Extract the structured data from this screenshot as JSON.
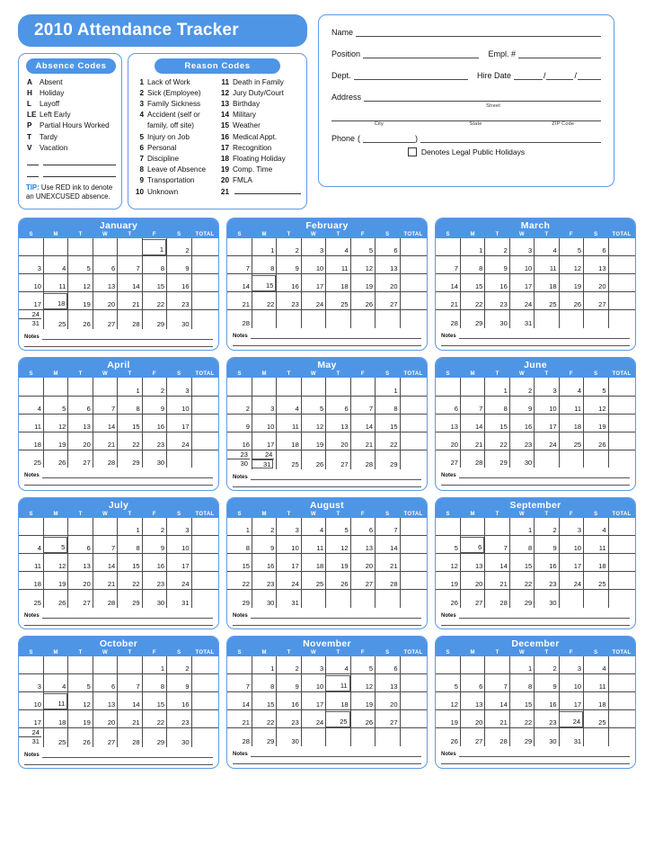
{
  "header": {
    "title": "2010 Attendance Tracker"
  },
  "absence_codes": {
    "heading": "Absence Codes",
    "items": [
      {
        "code": "A",
        "label": "Absent"
      },
      {
        "code": "H",
        "label": "Holiday"
      },
      {
        "code": "L",
        "label": "Layoff"
      },
      {
        "code": "LE",
        "label": "Left Early"
      },
      {
        "code": "P",
        "label": "Partial Hours Worked"
      },
      {
        "code": "T",
        "label": "Tardy"
      },
      {
        "code": "V",
        "label": "Vacation"
      }
    ],
    "blank_rows": 2,
    "tip_keyword": "TIP:",
    "tip_text": " Use RED ink to denote an UNEXCUSED absence.",
    "tip_color": "#2a7fd4"
  },
  "reason_codes": {
    "heading": "Reason Codes",
    "column_left": [
      {
        "code": "1",
        "label": "Lack of Work"
      },
      {
        "code": "2",
        "label": "Sick (Employee)"
      },
      {
        "code": "3",
        "label": "Family Sickness"
      },
      {
        "code": "4",
        "label": "Accident (self or family, off site)"
      },
      {
        "code": "5",
        "label": "Injury on Job"
      },
      {
        "code": "6",
        "label": "Personal"
      },
      {
        "code": "7",
        "label": "Discipline"
      },
      {
        "code": "8",
        "label": "Leave of Absence"
      },
      {
        "code": "9",
        "label": "Transportation"
      },
      {
        "code": "10",
        "label": "Unknown"
      }
    ],
    "column_right": [
      {
        "code": "11",
        "label": "Death in Family"
      },
      {
        "code": "12",
        "label": "Jury Duty/Court"
      },
      {
        "code": "13",
        "label": "Birthday"
      },
      {
        "code": "14",
        "label": "Military"
      },
      {
        "code": "15",
        "label": "Weather"
      },
      {
        "code": "16",
        "label": "Medical Appt."
      },
      {
        "code": "17",
        "label": "Recognition"
      },
      {
        "code": "18",
        "label": "Floating Holiday"
      },
      {
        "code": "19",
        "label": "Comp. Time"
      },
      {
        "code": "20",
        "label": "FMLA"
      },
      {
        "code": "21",
        "label": ""
      }
    ]
  },
  "employee_form": {
    "name_label": "Name",
    "position_label": "Position",
    "empl_num_label": "Empl. #",
    "dept_label": "Dept.",
    "hire_date_label": "Hire Date",
    "hire_date_sep": "/",
    "address_label": "Address",
    "street_caption": "Street",
    "city_caption": "City",
    "state_caption": "State",
    "zip_caption": "ZIP Code",
    "phone_label": "Phone",
    "phone_paren_open": "(",
    "phone_paren_close": ")",
    "holiday_checkbox_label": "Denotes Legal Public Holidays"
  },
  "calendar": {
    "dow": [
      "S",
      "M",
      "T",
      "W",
      "T",
      "F",
      "S"
    ],
    "total_label": "TOTAL",
    "notes_label": "Notes",
    "accent_color": "#4e95e6",
    "border_color": "#5b9ae8",
    "holiday_outline_color": "#5a5a5a",
    "months": [
      {
        "name": "January",
        "weeks": [
          [
            "",
            "",
            "",
            "",
            "",
            "1",
            "2"
          ],
          [
            "3",
            "4",
            "5",
            "6",
            "7",
            "8",
            "9"
          ],
          [
            "10",
            "11",
            "12",
            "13",
            "14",
            "15",
            "16"
          ],
          [
            "17",
            "18",
            "19",
            "20",
            "21",
            "22",
            "23"
          ],
          [
            {
              "split": [
                "24",
                "31"
              ]
            },
            "25",
            "26",
            "27",
            "28",
            "29",
            "30"
          ]
        ],
        "holidays": [
          "1",
          "18"
        ]
      },
      {
        "name": "February",
        "weeks": [
          [
            "",
            "1",
            "2",
            "3",
            "4",
            "5",
            "6"
          ],
          [
            "7",
            "8",
            "9",
            "10",
            "11",
            "12",
            "13"
          ],
          [
            "14",
            "15",
            "16",
            "17",
            "18",
            "19",
            "20"
          ],
          [
            "21",
            "22",
            "23",
            "24",
            "25",
            "26",
            "27"
          ],
          [
            "28",
            "",
            "",
            "",
            "",
            "",
            ""
          ]
        ],
        "holidays": [
          "15"
        ]
      },
      {
        "name": "March",
        "weeks": [
          [
            "",
            "1",
            "2",
            "3",
            "4",
            "5",
            "6"
          ],
          [
            "7",
            "8",
            "9",
            "10",
            "11",
            "12",
            "13"
          ],
          [
            "14",
            "15",
            "16",
            "17",
            "18",
            "19",
            "20"
          ],
          [
            "21",
            "22",
            "23",
            "24",
            "25",
            "26",
            "27"
          ],
          [
            "28",
            "29",
            "30",
            "31",
            "",
            "",
            ""
          ]
        ],
        "holidays": []
      },
      {
        "name": "April",
        "weeks": [
          [
            "",
            "",
            "",
            "",
            "1",
            "2",
            "3"
          ],
          [
            "4",
            "5",
            "6",
            "7",
            "8",
            "9",
            "10"
          ],
          [
            "11",
            "12",
            "13",
            "14",
            "15",
            "16",
            "17"
          ],
          [
            "18",
            "19",
            "20",
            "21",
            "22",
            "23",
            "24"
          ],
          [
            "25",
            "26",
            "27",
            "28",
            "29",
            "30",
            ""
          ]
        ],
        "holidays": []
      },
      {
        "name": "May",
        "weeks": [
          [
            "",
            "",
            "",
            "",
            "",
            "",
            "1"
          ],
          [
            "2",
            "3",
            "4",
            "5",
            "6",
            "7",
            "8"
          ],
          [
            "9",
            "10",
            "11",
            "12",
            "13",
            "14",
            "15"
          ],
          [
            "16",
            "17",
            "18",
            "19",
            "20",
            "21",
            "22"
          ],
          [
            {
              "split": [
                "23",
                "30"
              ]
            },
            {
              "split": [
                "24",
                "31"
              ]
            },
            "25",
            "26",
            "27",
            "28",
            "29"
          ]
        ],
        "holidays": [
          "31"
        ]
      },
      {
        "name": "June",
        "weeks": [
          [
            "",
            "",
            "1",
            "2",
            "3",
            "4",
            "5"
          ],
          [
            "6",
            "7",
            "8",
            "9",
            "10",
            "11",
            "12"
          ],
          [
            "13",
            "14",
            "15",
            "16",
            "17",
            "18",
            "19"
          ],
          [
            "20",
            "21",
            "22",
            "23",
            "24",
            "25",
            "26"
          ],
          [
            "27",
            "28",
            "29",
            "30",
            "",
            "",
            ""
          ]
        ],
        "holidays": []
      },
      {
        "name": "July",
        "weeks": [
          [
            "",
            "",
            "",
            "",
            "1",
            "2",
            "3"
          ],
          [
            "4",
            "5",
            "6",
            "7",
            "8",
            "9",
            "10"
          ],
          [
            "11",
            "12",
            "13",
            "14",
            "15",
            "16",
            "17"
          ],
          [
            "18",
            "19",
            "20",
            "21",
            "22",
            "23",
            "24"
          ],
          [
            "25",
            "26",
            "27",
            "28",
            "29",
            "30",
            "31"
          ]
        ],
        "holidays": [
          "5"
        ]
      },
      {
        "name": "August",
        "weeks": [
          [
            "1",
            "2",
            "3",
            "4",
            "5",
            "6",
            "7"
          ],
          [
            "8",
            "9",
            "10",
            "11",
            "12",
            "13",
            "14"
          ],
          [
            "15",
            "16",
            "17",
            "18",
            "19",
            "20",
            "21"
          ],
          [
            "22",
            "23",
            "24",
            "25",
            "26",
            "27",
            "28"
          ],
          [
            "29",
            "30",
            "31",
            "",
            "",
            "",
            ""
          ]
        ],
        "holidays": []
      },
      {
        "name": "September",
        "weeks": [
          [
            "",
            "",
            "",
            "1",
            "2",
            "3",
            "4"
          ],
          [
            "5",
            "6",
            "7",
            "8",
            "9",
            "10",
            "11"
          ],
          [
            "12",
            "13",
            "14",
            "15",
            "16",
            "17",
            "18"
          ],
          [
            "19",
            "20",
            "21",
            "22",
            "23",
            "24",
            "25"
          ],
          [
            "26",
            "27",
            "28",
            "29",
            "30",
            "",
            ""
          ]
        ],
        "holidays": [
          "6"
        ]
      },
      {
        "name": "October",
        "weeks": [
          [
            "",
            "",
            "",
            "",
            "",
            "1",
            "2"
          ],
          [
            "3",
            "4",
            "5",
            "6",
            "7",
            "8",
            "9"
          ],
          [
            "10",
            "11",
            "12",
            "13",
            "14",
            "15",
            "16"
          ],
          [
            "17",
            "18",
            "19",
            "20",
            "21",
            "22",
            "23"
          ],
          [
            {
              "split": [
                "24",
                "31"
              ]
            },
            "25",
            "26",
            "27",
            "28",
            "29",
            "30"
          ]
        ],
        "holidays": [
          "11"
        ]
      },
      {
        "name": "November",
        "weeks": [
          [
            "",
            "1",
            "2",
            "3",
            "4",
            "5",
            "6"
          ],
          [
            "7",
            "8",
            "9",
            "10",
            "11",
            "12",
            "13"
          ],
          [
            "14",
            "15",
            "16",
            "17",
            "18",
            "19",
            "20"
          ],
          [
            "21",
            "22",
            "23",
            "24",
            "25",
            "26",
            "27"
          ],
          [
            "28",
            "29",
            "30",
            "",
            "",
            "",
            ""
          ]
        ],
        "holidays": [
          "11",
          "25"
        ]
      },
      {
        "name": "December",
        "weeks": [
          [
            "",
            "",
            "",
            "1",
            "2",
            "3",
            "4"
          ],
          [
            "5",
            "6",
            "7",
            "8",
            "9",
            "10",
            "11"
          ],
          [
            "12",
            "13",
            "14",
            "15",
            "16",
            "17",
            "18"
          ],
          [
            "19",
            "20",
            "21",
            "22",
            "23",
            "24",
            "25"
          ],
          [
            "26",
            "27",
            "28",
            "29",
            "30",
            "31",
            ""
          ]
        ],
        "holidays": [
          "24"
        ]
      }
    ]
  }
}
